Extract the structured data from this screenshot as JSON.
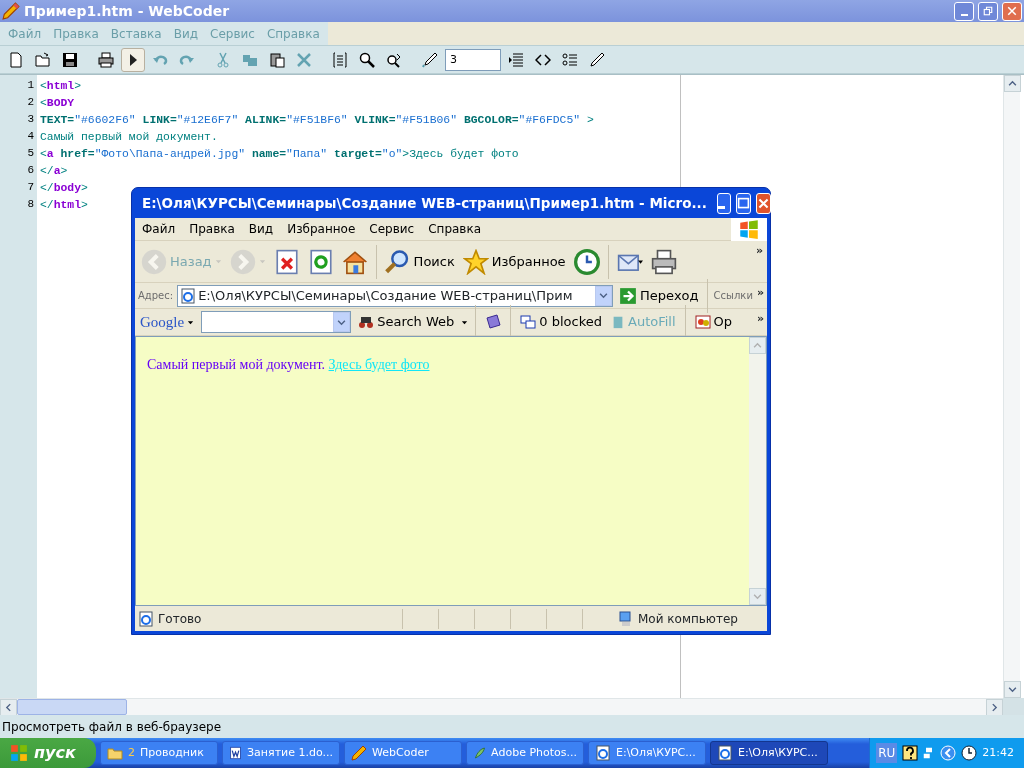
{
  "editor_window": {
    "title": "Пример1.htm - WebCoder",
    "menu": [
      "Файл",
      "Правка",
      "Вставка",
      "Вид",
      "Сервис",
      "Справка"
    ],
    "toolbar": [
      {
        "kind": "new",
        "pressed": false,
        "disabled": false
      },
      {
        "kind": "open",
        "pressed": false,
        "disabled": false
      },
      {
        "kind": "save",
        "pressed": false,
        "disabled": false
      },
      {
        "kind": "sep"
      },
      {
        "kind": "print",
        "pressed": false,
        "disabled": false
      },
      {
        "kind": "run",
        "pressed": true,
        "disabled": false
      },
      {
        "kind": "undo",
        "pressed": false,
        "disabled": true
      },
      {
        "kind": "redo",
        "pressed": false,
        "disabled": true
      },
      {
        "kind": "sep"
      },
      {
        "kind": "cut",
        "pressed": false,
        "disabled": true
      },
      {
        "kind": "copy",
        "pressed": false,
        "disabled": true
      },
      {
        "kind": "paste",
        "pressed": false,
        "disabled": false
      },
      {
        "kind": "delete",
        "pressed": false,
        "disabled": true
      },
      {
        "kind": "sep"
      },
      {
        "kind": "format",
        "pressed": false,
        "disabled": false
      },
      {
        "kind": "find",
        "pressed": false,
        "disabled": false
      },
      {
        "kind": "replace",
        "pressed": false,
        "disabled": false
      },
      {
        "kind": "sep"
      },
      {
        "kind": "picker",
        "pressed": false,
        "disabled": false
      },
      {
        "kind": "field",
        "value": "3"
      },
      {
        "kind": "lines",
        "pressed": false,
        "disabled": false
      },
      {
        "kind": "tags",
        "pressed": false,
        "disabled": false
      },
      {
        "kind": "list",
        "pressed": false,
        "disabled": false
      },
      {
        "kind": "pen",
        "pressed": false,
        "disabled": false
      }
    ],
    "code_lines": [
      {
        "number": "1",
        "tokens": [
          {
            "kind": "punct",
            "text": "<"
          },
          {
            "kind": "tag",
            "text": "html"
          },
          {
            "kind": "punct",
            "text": ">"
          }
        ]
      },
      {
        "number": "2",
        "tokens": [
          {
            "kind": "punct",
            "text": "<"
          },
          {
            "kind": "tag",
            "text": "BODY"
          }
        ]
      },
      {
        "number": "3",
        "tokens": [
          {
            "kind": "attr",
            "text": "TEXT="
          },
          {
            "kind": "value",
            "text": "\"#6602F6\""
          },
          {
            "kind": "attr",
            "text": " LINK="
          },
          {
            "kind": "value",
            "text": "\"#12E6F7\""
          },
          {
            "kind": "attr",
            "text": " ALINK="
          },
          {
            "kind": "value",
            "text": "\"#F51BF6\""
          },
          {
            "kind": "attr",
            "text": " VLINK="
          },
          {
            "kind": "value",
            "text": "\"#F51B06\""
          },
          {
            "kind": "attr",
            "text": " BGCOLOR="
          },
          {
            "kind": "value",
            "text": "\"#F6FDC5\""
          },
          {
            "kind": "punct",
            "text": " >"
          }
        ]
      },
      {
        "number": "4",
        "tokens": [
          {
            "kind": "text",
            "text": "Самый первый мой документ."
          }
        ]
      },
      {
        "number": "5",
        "tokens": [
          {
            "kind": "punct",
            "text": "<"
          },
          {
            "kind": "tag",
            "text": "a"
          },
          {
            "kind": "attr",
            "text": " href="
          },
          {
            "kind": "value",
            "text": "\"Фото\\Папа-андрей.jpg\""
          },
          {
            "kind": "attr",
            "text": " name="
          },
          {
            "kind": "value",
            "text": "\"Папа\""
          },
          {
            "kind": "attr",
            "text": " target="
          },
          {
            "kind": "value",
            "text": "\"o\""
          },
          {
            "kind": "punct",
            "text": ">"
          },
          {
            "kind": "text",
            "text": "Здесь будет фото"
          }
        ]
      },
      {
        "number": "6",
        "tokens": [
          {
            "kind": "punct",
            "text": "</"
          },
          {
            "kind": "tag",
            "text": "a"
          },
          {
            "kind": "punct",
            "text": ">"
          }
        ]
      },
      {
        "number": "7",
        "tokens": [
          {
            "kind": "punct",
            "text": "</"
          },
          {
            "kind": "tag",
            "text": "body"
          },
          {
            "kind": "punct",
            "text": ">"
          }
        ]
      },
      {
        "number": "8",
        "tokens": [
          {
            "kind": "punct",
            "text": "</"
          },
          {
            "kind": "tag",
            "text": "html"
          },
          {
            "kind": "punct",
            "text": ">"
          }
        ]
      }
    ],
    "status_bar": "Просмотреть файл в веб-браузере"
  },
  "browser_window": {
    "title": "E:\\Оля\\КУРСЫ\\Семинары\\Создание WEB-страниц\\Пример1.htm - Micro...",
    "menu": [
      "Файл",
      "Правка",
      "Вид",
      "Избранное",
      "Сервис",
      "Справка"
    ],
    "toolbar": [
      {
        "kind": "back",
        "label": "Назад",
        "disabled": true
      },
      {
        "kind": "forward",
        "disabled": true
      },
      {
        "kind": "stop",
        "disabled": false
      },
      {
        "kind": "refresh",
        "disabled": false
      },
      {
        "kind": "home",
        "disabled": false
      },
      {
        "kind": "sep"
      },
      {
        "kind": "search",
        "label": "Поиск",
        "disabled": false
      },
      {
        "kind": "favorites",
        "label": "Избранное",
        "disabled": false
      },
      {
        "kind": "history",
        "disabled": false
      },
      {
        "kind": "sep"
      },
      {
        "kind": "mail",
        "disabled": false
      },
      {
        "kind": "print",
        "disabled": false
      }
    ],
    "toolbar_more": "»",
    "address": {
      "label": "Адрес:",
      "value": "E:\\Оля\\КУРСЫ\\Семинары\\Создание WEB-страниц\\Прим",
      "go": "Переход",
      "links": "Ссылки",
      "more": "»"
    },
    "google_bar": {
      "logo": "Google",
      "search_web": "Search Web",
      "blocked": "0 blocked",
      "autofill": "AutoFill",
      "options": "Op",
      "more": "»"
    },
    "page": {
      "text": "Самый первый мой документ.",
      "link": "Здесь будет фото"
    },
    "status": {
      "text": "Готово",
      "zone": "Мой компьютер"
    }
  },
  "taskbar": {
    "start": "пуск",
    "buttons": [
      {
        "kind": "folder",
        "count": "2",
        "label": "Проводник",
        "selected": false
      },
      {
        "kind": "document",
        "label": "Занятие 1.do...",
        "selected": false
      },
      {
        "kind": "editor",
        "label": "WebCoder",
        "selected": false
      },
      {
        "kind": "graphics",
        "label": "Adobe Photos...",
        "selected": false
      },
      {
        "kind": "browser",
        "label": "E:\\Оля\\КУРС...",
        "selected": false
      },
      {
        "kind": "browser",
        "label": "E:\\Оля\\КУРС...",
        "selected": true
      }
    ],
    "language": "RU",
    "time": "21:42"
  }
}
